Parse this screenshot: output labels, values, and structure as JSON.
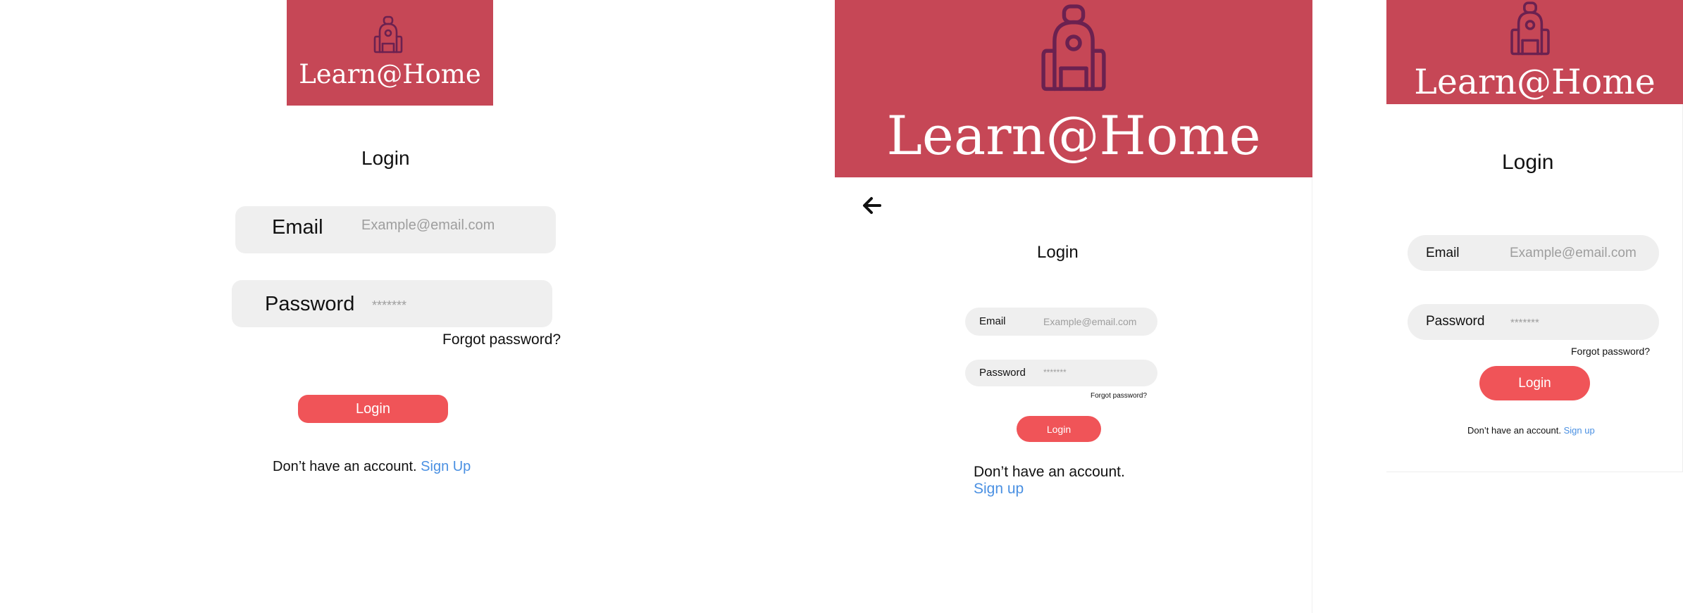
{
  "colors": {
    "banner": "#c64756",
    "icon_stroke": "#6b2150",
    "field_bg": "#efefef",
    "button_bg": "#f05458",
    "link": "#4a90e2",
    "placeholder": "#9e9e9e"
  },
  "icons": {
    "logo": "backpack-icon",
    "back": "arrow-left-icon"
  },
  "screen1": {
    "brand": "Learn@Home",
    "title": "Login",
    "email_label": "Email",
    "email_placeholder": "Example@email.com",
    "password_label": "Password",
    "password_placeholder": "*******",
    "forgot": "Forgot password?",
    "login_button": "Login",
    "no_account": "Don’t have an account.",
    "signup": "Sign Up"
  },
  "screen2": {
    "brand": "Learn@Home",
    "title": "Login",
    "email_label": "Email",
    "email_placeholder": "Example@email.com",
    "password_label": "Password",
    "password_placeholder": "*******",
    "forgot": "Forgot password?",
    "login_button": "Login",
    "no_account": "Don’t have an account.",
    "signup": "Sign up"
  },
  "screen3": {
    "brand": "Learn@Home",
    "title": "Login",
    "email_label": "Email",
    "email_placeholder": "Example@email.com",
    "password_label": "Password",
    "password_placeholder": "*******",
    "forgot": "Forgot password?",
    "login_button": "Login",
    "no_account": "Don’t have an account.",
    "signup": "Sign up"
  }
}
